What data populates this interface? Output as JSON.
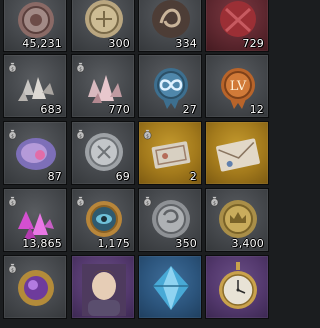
{
  "grid": {
    "columns": 4,
    "slots": [
      {
        "item": "seal-icon",
        "rarity": "gray",
        "bag": false,
        "qty": "45,231"
      },
      {
        "item": "medal-coin-icon",
        "rarity": "gray",
        "bag": false,
        "qty": "300"
      },
      {
        "item": "serpent-emblem-icon",
        "rarity": "gray",
        "bag": false,
        "qty": "334"
      },
      {
        "item": "red-wax-seal-icon",
        "rarity": "red",
        "bag": false,
        "qty": "729"
      },
      {
        "item": "gray-crystals-icon",
        "rarity": "gray",
        "bag": true,
        "qty": "683"
      },
      {
        "item": "pink-crystals-icon",
        "rarity": "gray",
        "bag": true,
        "qty": "770"
      },
      {
        "item": "infinity-badge-icon",
        "rarity": "gray",
        "bag": false,
        "qty": "27"
      },
      {
        "item": "level-badge-icon",
        "rarity": "gray",
        "bag": false,
        "qty": "12",
        "badge_text": "LV"
      },
      {
        "item": "cosmic-orb-icon",
        "rarity": "gray",
        "bag": true,
        "qty": "87"
      },
      {
        "item": "silver-coin-icon",
        "rarity": "gray",
        "bag": true,
        "qty": "69"
      },
      {
        "item": "ticket-icon",
        "rarity": "gold",
        "bag": true,
        "qty": "2"
      },
      {
        "item": "letter-icon",
        "rarity": "gold",
        "bag": false,
        "qty": ""
      },
      {
        "item": "magenta-crystals-icon",
        "rarity": "gray",
        "bag": true,
        "qty": "13,865"
      },
      {
        "item": "eye-medallion-icon",
        "rarity": "gray",
        "bag": true,
        "qty": "1,175"
      },
      {
        "item": "silver-emblem-coin-icon",
        "rarity": "gray",
        "bag": true,
        "qty": "350"
      },
      {
        "item": "crown-coin-icon",
        "rarity": "gray",
        "bag": true,
        "qty": "3,400"
      },
      {
        "item": "purple-orb-amulet-icon",
        "rarity": "gray",
        "bag": true,
        "qty": ""
      },
      {
        "item": "portrait-icon",
        "rarity": "purple",
        "bag": false,
        "qty": ""
      },
      {
        "item": "blue-gem-icon",
        "rarity": "blue",
        "bag": false,
        "qty": ""
      },
      {
        "item": "pocket-watch-icon",
        "rarity": "purple",
        "bag": false,
        "qty": ""
      }
    ]
  }
}
